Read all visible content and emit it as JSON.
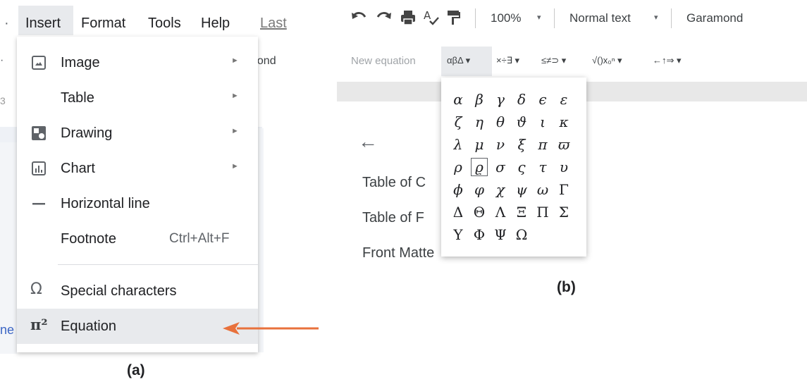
{
  "panel_a": {
    "menubar": {
      "edge": "·",
      "items": [
        "Insert",
        "Format",
        "Tools",
        "Help",
        "Last"
      ]
    },
    "edge_texts": {
      "left_top": "·",
      "font_fragment": "nond",
      "left_3": "3",
      "left_ne": "ne"
    },
    "insert_menu": {
      "items": [
        {
          "label": "Image",
          "icon": "image-icon",
          "submenu": true
        },
        {
          "label": "Table",
          "icon": "",
          "submenu": true
        },
        {
          "label": "Drawing",
          "icon": "drawing-icon",
          "submenu": true
        },
        {
          "label": "Chart",
          "icon": "chart-icon",
          "submenu": true
        },
        {
          "label": "Horizontal line",
          "icon": "horizontal-line-icon",
          "submenu": false
        },
        {
          "label": "Footnote",
          "icon": "",
          "shortcut": "Ctrl+Alt+F",
          "submenu": false
        },
        {
          "label": "Special characters",
          "icon": "omega-icon",
          "submenu": false
        },
        {
          "label": "Equation",
          "icon": "pi-icon",
          "submenu": false,
          "highlighted": true
        }
      ],
      "submenu_arrow": "►",
      "special_glyph": "Ω",
      "pi_glyph": "π²"
    },
    "caption": "(a)",
    "arrow_color": "#e8713c"
  },
  "panel_b": {
    "toolbar": {
      "zoom": "100%",
      "style": "Normal text",
      "font": "Garamond",
      "caret": "▾"
    },
    "equation_toolbar": {
      "new_equation": "New equation",
      "menus": [
        "αβΔ ▾",
        "×÷∃ ▾",
        "≤≠⊃ ▾",
        "√()x₀ⁿ ▾",
        "←↑⇒ ▾"
      ]
    },
    "document": {
      "back_arrow": "←",
      "links": [
        "Table of C",
        "Table of F",
        "Front Matte"
      ]
    },
    "greek_symbols": [
      [
        "α",
        "β",
        "γ",
        "δ",
        "ϵ",
        "ε"
      ],
      [
        "ζ",
        "η",
        "θ",
        "ϑ",
        "ι",
        "κ"
      ],
      [
        "λ",
        "μ",
        "ν",
        "ξ",
        "π",
        "ϖ"
      ],
      [
        "ρ",
        "ϱ",
        "σ",
        "ς",
        "τ",
        "υ"
      ],
      [
        "ϕ",
        "φ",
        "χ",
        "ψ",
        "ω",
        "Γ"
      ],
      [
        "Δ",
        "Θ",
        "Λ",
        "Ξ",
        "Π",
        "Σ"
      ],
      [
        "Υ",
        "Φ",
        "Ψ",
        "Ω"
      ]
    ],
    "selected_symbol": "ϱ",
    "caption": "(b)"
  }
}
